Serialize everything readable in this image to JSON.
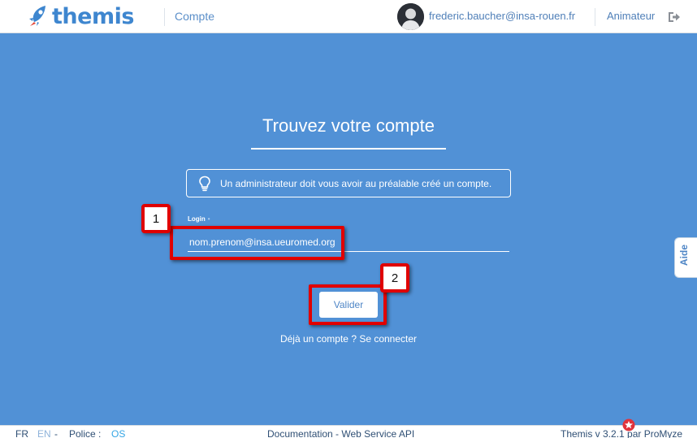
{
  "header": {
    "brand": "themis",
    "section": "Compte",
    "user_email": "frederic.baucher@insa-rouen.fr",
    "role": "Animateur",
    "brand_color": "#3e86cf",
    "logout_icon": "logout-icon"
  },
  "main": {
    "title": "Trouvez votre compte",
    "info": "Un administrateur doit vous avoir au préalable créé un compte.",
    "info_icon": "lightbulb-icon",
    "login_label": "Login",
    "login_value": "nom.prenom@insa.ueuromed.org",
    "submit_label": "Valider",
    "have_account": "Déjà un compte ? Se connecter",
    "background": "#5191d6"
  },
  "annotations": {
    "badge_1": "1",
    "badge_2": "2",
    "color": "#e00000"
  },
  "side": {
    "help_label": "Aide"
  },
  "footer": {
    "lang_fr": "FR",
    "lang_en": "EN",
    "sep": "-",
    "font_label": "Police :",
    "font_value": "OS",
    "links": "Documentation - Web Service API",
    "version": "Themis v 3.2.1 par ProMyze"
  }
}
